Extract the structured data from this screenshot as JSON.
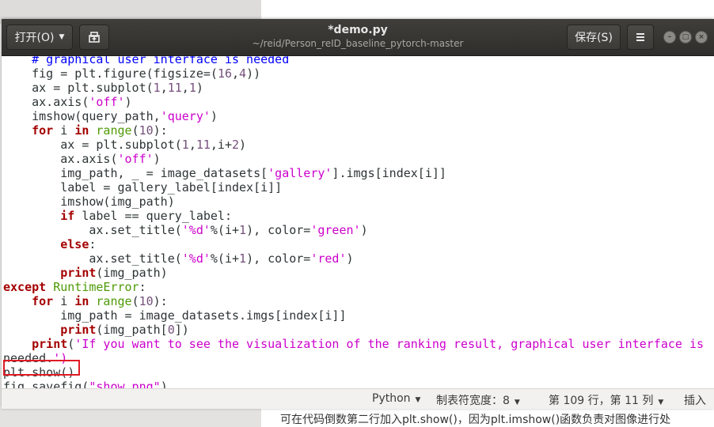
{
  "background": {
    "bottom_text": "可在代码倒数第二行加入plt.show()，因为plt.imshow()函数负责对图像进行处"
  },
  "header": {
    "open_label": "打开(O)",
    "title": "*demo.py",
    "subtitle": "~/reid/Person_reID_baseline_pytorch-master",
    "save_label": "保存(S)",
    "menu_icon": "hamburger-icon",
    "pin_icon": "new-tab-icon"
  },
  "code": {
    "lines": [
      "    # graphical user interface is needed",
      "    fig = plt.figure(figsize=(16,4))",
      "    ax = plt.subplot(1,11,1)",
      "    ax.axis('off')",
      "    imshow(query_path,'query')",
      "    for i in range(10):",
      "        ax = plt.subplot(1,11,i+2)",
      "        ax.axis('off')",
      "        img_path, _ = image_datasets['gallery'].imgs[index[i]]",
      "        label = gallery_label[index[i]]",
      "        imshow(img_path)",
      "        if label == query_label:",
      "            ax.set_title('%d'%(i+1), color='green')",
      "        else:",
      "            ax.set_title('%d'%(i+1), color='red')",
      "        print(img_path)",
      "except RuntimeError:",
      "    for i in range(10):",
      "        img_path = image_datasets.imgs[index[i]]",
      "        print(img_path[0])",
      "    print('If you want to see the visualization of the ranking result, graphical user interface is",
      "needed.')",
      "plt.show()",
      "fig.savefig(\"show.png\")"
    ],
    "highlighted_line": "plt.show()"
  },
  "status": {
    "language": "Python",
    "tab_width": "制表符宽度：8",
    "position": "第 109 行，第 11 列",
    "mode": "插入"
  },
  "colors": {
    "keyword": "#a40000",
    "string": "#cc00cc",
    "number": "#75507b",
    "builtin_class": "#4e9a06",
    "highlight_box": "#e01b24"
  }
}
